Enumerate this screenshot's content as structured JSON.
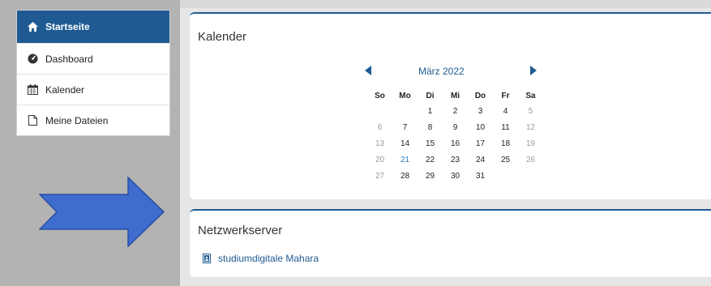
{
  "sidebar": {
    "items": [
      {
        "label": "Startseite",
        "icon": "home-icon"
      },
      {
        "label": "Dashboard",
        "icon": "dashboard-icon"
      },
      {
        "label": "Kalender",
        "icon": "calendar-icon"
      },
      {
        "label": "Meine Dateien",
        "icon": "file-icon"
      }
    ]
  },
  "calendar": {
    "title": "Kalender",
    "month": "März 2022",
    "weekdays": [
      "So",
      "Mo",
      "Di",
      "Mi",
      "Do",
      "Fr",
      "Sa"
    ],
    "weeks": [
      [
        "",
        "",
        "1",
        "2",
        "3",
        "4",
        "5"
      ],
      [
        "6",
        "7",
        "8",
        "9",
        "10",
        "11",
        "12"
      ],
      [
        "13",
        "14",
        "15",
        "16",
        "17",
        "18",
        "19"
      ],
      [
        "20",
        "21",
        "22",
        "23",
        "24",
        "25",
        "26"
      ],
      [
        "27",
        "28",
        "29",
        "30",
        "31",
        "",
        ""
      ]
    ],
    "highlighted_day": "21"
  },
  "network": {
    "title": "Netzwerkserver",
    "link": "studiumdigitale Mahara"
  },
  "colors": {
    "accent": "#1f5b92",
    "arrow": "#3f6ccf",
    "weekend": "#9a9a9a",
    "today": "#2a7fbf"
  }
}
